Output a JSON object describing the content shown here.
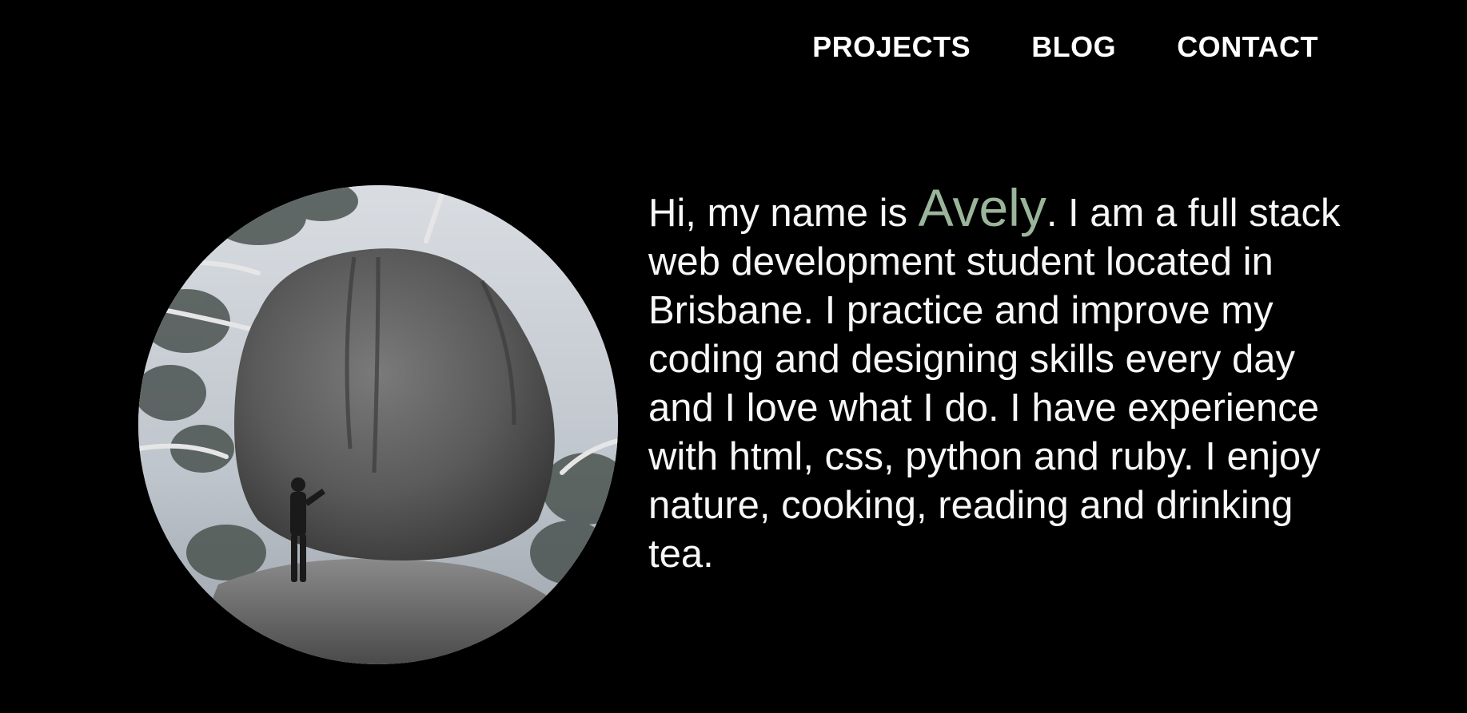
{
  "nav": {
    "items": [
      {
        "label": "PROJECTS"
      },
      {
        "label": "BLOG"
      },
      {
        "label": "CONTACT"
      }
    ]
  },
  "intro": {
    "prefix": "Hi, my name is ",
    "name": "Avely",
    "suffix": ". I am a full stack web development student located in Brisbane. I practice and improve my coding and designing skills every day and I love what I do. I have experience with html, css, python and ruby. I enjoy nature, cooking, reading and drinking tea."
  },
  "colors": {
    "background": "#000000",
    "text": "#f7f7f7",
    "accent_name": "#9ab59a"
  },
  "portrait": {
    "icon": "portrait-photo"
  }
}
